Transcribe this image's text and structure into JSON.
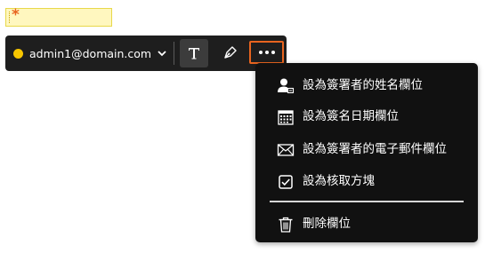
{
  "field": {
    "required_marker": "*"
  },
  "toolbar": {
    "signer_email": "admin1@domain.com",
    "signer_color": "#f7c600",
    "text_tool_icon": "text-T-icon",
    "pen_tool_icon": "pen-icon",
    "more_icon": "ellipsis-icon",
    "highlight_color": "#e8641f"
  },
  "menu": {
    "items": [
      {
        "label": "設為簽署者的姓名欄位",
        "icon": "user-name-icon"
      },
      {
        "label": "設為簽名日期欄位",
        "icon": "calendar-icon"
      },
      {
        "label": "設為簽署者的電子郵件欄位",
        "icon": "envelope-icon"
      },
      {
        "label": "設為核取方塊",
        "icon": "checkbox-icon"
      },
      {
        "label": "刪除欄位",
        "icon": "trash-icon"
      }
    ]
  }
}
